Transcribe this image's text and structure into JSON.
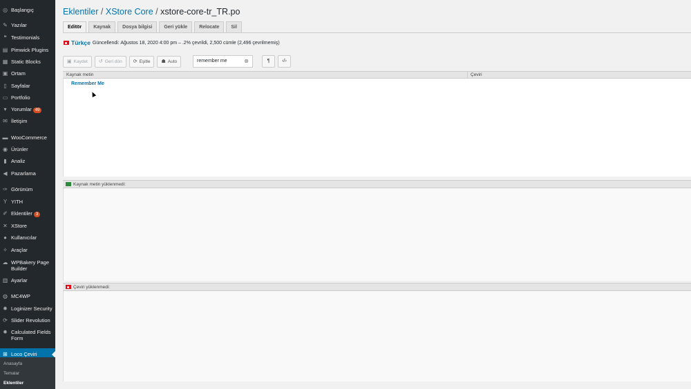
{
  "sidebar": {
    "items": [
      {
        "label": "Başlangıç",
        "icon": "dashboard-icon",
        "glyph": "◎"
      },
      {
        "label": "Yazılar",
        "icon": "pin-icon",
        "glyph": "✎"
      },
      {
        "label": "Testimonials",
        "icon": "quote-icon",
        "glyph": "❝"
      },
      {
        "label": "Pimwick Plugins",
        "icon": "plugin-icon",
        "glyph": "▤"
      },
      {
        "label": "Static Blocks",
        "icon": "blocks-icon",
        "glyph": "▦"
      },
      {
        "label": "Ortam",
        "icon": "media-icon",
        "glyph": "▣"
      },
      {
        "label": "Sayfalar",
        "icon": "pages-icon",
        "glyph": "▯"
      },
      {
        "label": "Portfolio",
        "icon": "portfolio-icon",
        "glyph": "▭"
      },
      {
        "label": "Yorumlar",
        "icon": "comments-icon",
        "glyph": "▾",
        "badge": "49"
      },
      {
        "label": "İletişim",
        "icon": "mail-icon",
        "glyph": "✉"
      },
      {
        "label": "WooCommerce",
        "icon": "woo-icon",
        "glyph": "▬"
      },
      {
        "label": "Ürünler",
        "icon": "products-icon",
        "glyph": "◉"
      },
      {
        "label": "Analiz",
        "icon": "analytics-icon",
        "glyph": "▮"
      },
      {
        "label": "Pazarlama",
        "icon": "marketing-icon",
        "glyph": "◀"
      },
      {
        "label": "Görünüm",
        "icon": "appearance-icon",
        "glyph": "✑"
      },
      {
        "label": "YITH",
        "icon": "yith-icon",
        "glyph": "Y"
      },
      {
        "label": "Eklentiler",
        "icon": "plugins-icon",
        "glyph": "✐",
        "badge": "3"
      },
      {
        "label": "XStore",
        "icon": "xstore-icon",
        "glyph": "✕"
      },
      {
        "label": "Kullanıcılar",
        "icon": "users-icon",
        "glyph": "●"
      },
      {
        "label": "Araçlar",
        "icon": "tools-icon",
        "glyph": "✧"
      },
      {
        "label": "WPBakery Page Builder",
        "icon": "wpbakery-icon",
        "glyph": "☁"
      },
      {
        "label": "Ayarlar",
        "icon": "settings-icon",
        "glyph": "▥"
      },
      {
        "label": "MC4WP",
        "icon": "mc4wp-icon",
        "glyph": "◍"
      },
      {
        "label": "Loginizer Security",
        "icon": "gear-icon",
        "glyph": "✹"
      },
      {
        "label": "Slider Revolution",
        "icon": "slider-icon",
        "glyph": "⟳"
      },
      {
        "label": "Calculated Fields Form",
        "icon": "calc-icon",
        "glyph": "✹"
      },
      {
        "label": "Loco Çeviri",
        "icon": "translate-icon",
        "glyph": "⊞"
      }
    ],
    "submenu": [
      "Anasayfa",
      "Temalar",
      "Eklentiler"
    ]
  },
  "header": {
    "crumb1": "Eklentiler",
    "sep": "/",
    "crumb2": "XStore Core",
    "file": "xstore-core-tr_TR.po"
  },
  "tabs": [
    "Editör",
    "Kaynak",
    "Dosya bilgisi",
    "Geri yükle",
    "Relocate",
    "Sil"
  ],
  "info": {
    "language": "Türkçe",
    "status": "Güncellendi: Ağustos 18, 2020 4:00 pm – .2% çevrildi, 2,500 cümle (2,496 çevrilmemiş)"
  },
  "toolbar": {
    "save": "Kaydet",
    "revert": "Geri dön",
    "sync": "Eşitle",
    "auto": "Auto",
    "search_value": "remember me",
    "pilcrow": "¶",
    "code": "‹/›"
  },
  "grid": {
    "col_source": "Kaynak metin",
    "col_translation": "Çeviri",
    "row1_source": "Remember Me"
  },
  "panes": {
    "source_status": "Kaynak metin yüklenmedi:",
    "translation_status": "Çeviri yüklenmedi:"
  }
}
